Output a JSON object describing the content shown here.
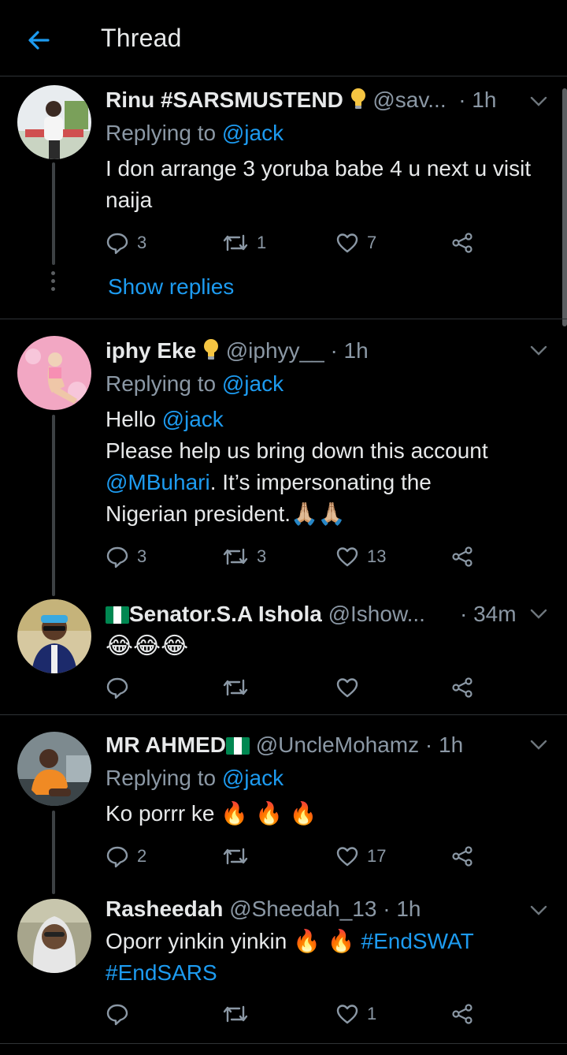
{
  "header": {
    "title": "Thread",
    "back_icon": "arrow-left-icon",
    "accent": "#1d9bf0"
  },
  "replying_label": "Replying to",
  "tweets": [
    {
      "name": "Rinu #SARSMUSTEND",
      "name_suffix_icon": "light-bulb-icon",
      "handle": "@sav...",
      "time": "· 1h",
      "replying_to": "@jack",
      "text": "I don arrange 3 yoruba babe 4 u next u visit naija",
      "replies": "3",
      "retweets": "1",
      "likes": "7",
      "show_replies": "Show replies"
    },
    {
      "name": "iphy Eke",
      "name_suffix_icon": "light-bulb-icon",
      "handle": "@iphyy__",
      "time": "· 1h",
      "replying_to": "@jack",
      "text_line1": "Hello ",
      "text_mention1": "@jack",
      "text_line2": "Please help us bring down this account",
      "text_mention2": "@MBuhari",
      "text_line3": ". It’s impersonating the",
      "text_line4": "Nigerian president.",
      "text_emoji": "🙏🏼🙏🏼",
      "replies": "3",
      "retweets": "3",
      "likes": "13"
    },
    {
      "name_prefix_icon": "nigeria-flag-icon",
      "name": "Senator.S.A Ishola",
      "handle": "@Ishow...",
      "time": "· 34m",
      "text": "😂😂😂",
      "replies": "",
      "retweets": "",
      "likes": ""
    },
    {
      "name": "MR AHMED",
      "name_suffix_icon": "nigeria-flag-icon",
      "handle": "@UncleMohamz",
      "time": "· 1h",
      "replying_to": "@jack",
      "text": "Ko porrr ke ",
      "text_emoji": "🔥 🔥 🔥",
      "replies": "2",
      "retweets": "",
      "likes": "17"
    },
    {
      "name": "Rasheedah",
      "handle": "@Sheedah_13",
      "time": "· 1h",
      "text": "Oporr yinkin yinkin ",
      "text_emoji": "🔥 🔥",
      "hashtag1": "#EndSWAT",
      "hashtag2": "#EndSARS",
      "replies": "",
      "retweets": "",
      "likes": "1"
    }
  ]
}
